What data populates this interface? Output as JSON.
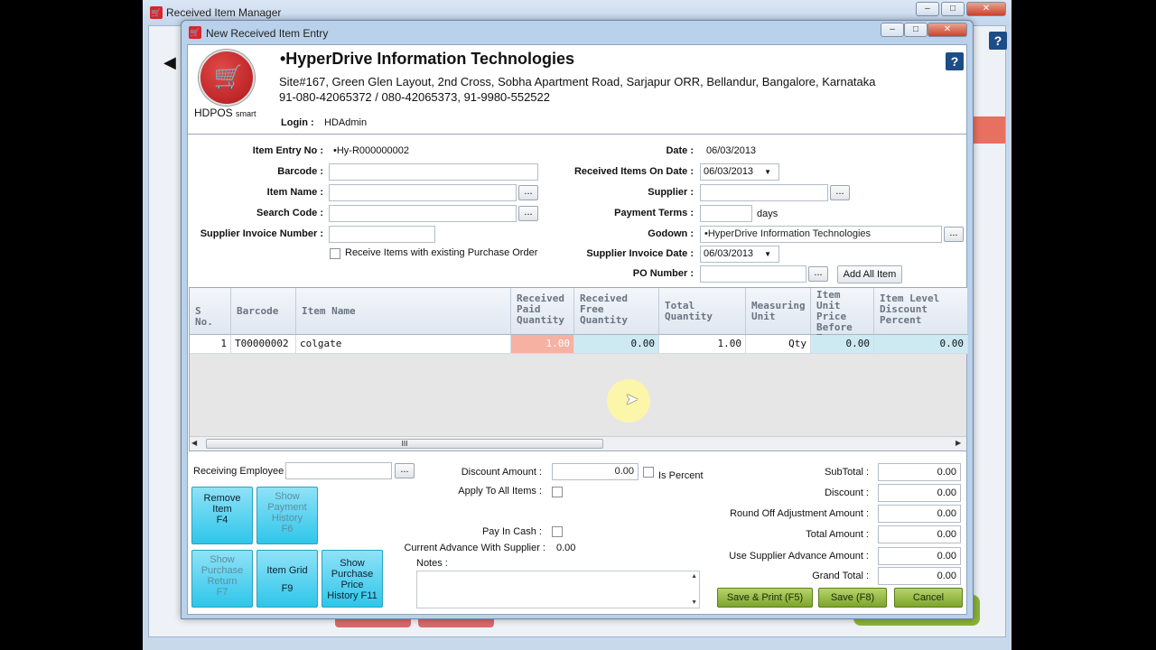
{
  "outer_window": {
    "title": "Received Item Manager"
  },
  "dialog": {
    "title": "New Received Item Entry"
  },
  "company": {
    "logo_text": "HDPOS",
    "logo_suffix": "smart",
    "name": "•HyperDrive Information Technologies",
    "address": "Site#167, Green Glen Layout, 2nd Cross, Sobha Apartment Road, Sarjapur ORR, Bellandur, Bangalore, Karnataka",
    "phones": "91-080-42065372 / 080-42065373, 91-9980-552522",
    "login_label": "Login :",
    "login_value": "HDAdmin"
  },
  "form": {
    "item_entry_no_label": "Item Entry No :",
    "item_entry_no": "•Hy-R000000002",
    "barcode_label": "Barcode :",
    "item_name_label": "Item Name :",
    "search_code_label": "Search Code :",
    "supplier_invoice_number_label": "Supplier Invoice Number :",
    "receive_po_label": "Receive Items with existing Purchase Order",
    "date_label": "Date :",
    "date": "06/03/2013",
    "received_on_label": "Received Items On Date :",
    "received_on": "06/03/2013",
    "supplier_label": "Supplier :",
    "payment_terms_label": "Payment Terms :",
    "days": "days",
    "godown_label": "Godown :",
    "godown": "•HyperDrive Information Technologies",
    "supplier_invoice_date_label": "Supplier Invoice Date :",
    "supplier_invoice_date": "06/03/2013",
    "po_number_label": "PO Number :",
    "add_all_item": "Add All Item",
    "ellipsis": "..."
  },
  "grid": {
    "columns": [
      "S No.",
      "Barcode",
      "Item Name",
      "Received Paid Quantity",
      "Received Free Quantity",
      "Total Quantity",
      "Measuring Unit",
      "Item Unit Price Before Tax",
      "Item Level Discount Percent"
    ],
    "rows": [
      {
        "sno": "1",
        "barcode": "T00000002",
        "item_name": "colgate",
        "paid_qty": "1.00",
        "free_qty": "0.00",
        "total_qty": "1.00",
        "unit": "Qty",
        "unit_price": "0.00",
        "discount_pct": "0.00"
      }
    ],
    "scroll_grip": "III"
  },
  "bottom": {
    "receiving_employee_label": "Receiving Employee :",
    "discount_amount_label": "Discount Amount :",
    "discount_amount": "0.00",
    "is_percent_label": "Is Percent",
    "apply_to_all_label": "Apply To All Items :",
    "pay_in_cash_label": "Pay In Cash :",
    "current_advance_label": "Current Advance With Supplier :",
    "current_advance": "0.00",
    "notes_label": "Notes :",
    "subtotal_label": "SubTotal :",
    "subtotal": "0.00",
    "discount_label": "Discount :",
    "discount": "0.00",
    "roundoff_label": "Round Off Adjustment Amount :",
    "roundoff": "0.00",
    "total_label": "Total Amount :",
    "total": "0.00",
    "use_adv_label": "Use Supplier Advance Amount :",
    "use_adv": "0.00",
    "grand_label": "Grand Total :",
    "grand": "0.00"
  },
  "buttons": {
    "remove_item": [
      "Remove",
      "Item",
      "F4"
    ],
    "show_payment": [
      "Show",
      "Payment",
      "History",
      "F6"
    ],
    "show_return": [
      "Show",
      "Purchase",
      "Return",
      "F7"
    ],
    "item_grid": [
      "Item Grid",
      "F9"
    ],
    "show_price": [
      "Show",
      "Purchase",
      "Price",
      "History  F11"
    ],
    "save_print": "Save & Print (F5)",
    "save": "Save (F8)",
    "cancel": "Cancel"
  },
  "colors": {
    "paid_qty_bg": "#f7b1a2",
    "free_qty_bg": "#cdeaf3",
    "function_button": "#40cbee",
    "action_button": "#9bbf43"
  }
}
